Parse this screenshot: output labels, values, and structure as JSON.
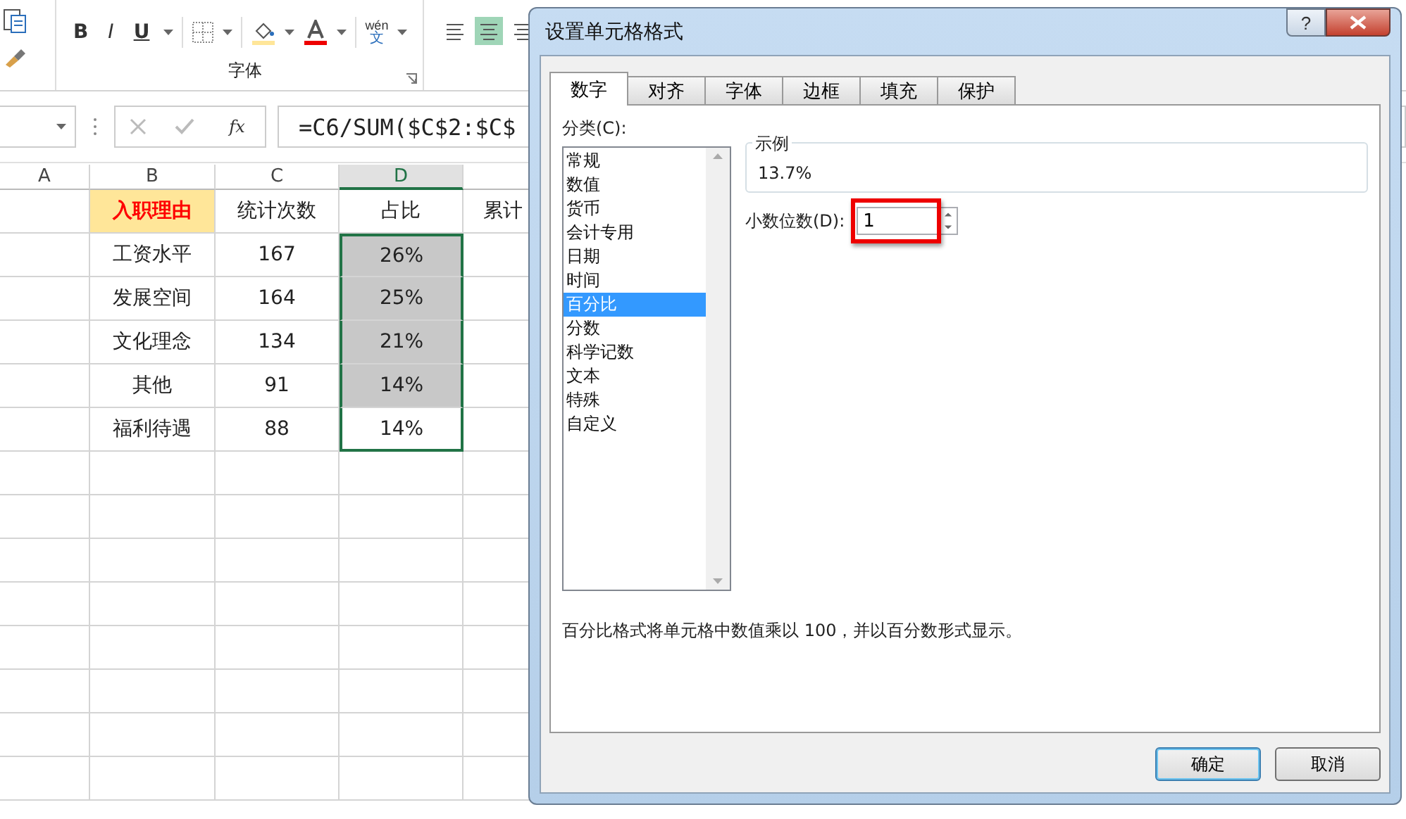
{
  "ribbon": {
    "font_buttons": [
      {
        "kind": "bold",
        "label": "B"
      },
      {
        "kind": "italic",
        "label": "I"
      },
      {
        "kind": "underline",
        "label": "U"
      }
    ],
    "phonetic": {
      "top": "wén",
      "bottom": "文"
    },
    "font_group_label": "字体",
    "align_buttons": [
      {
        "kind": "left",
        "selected": false
      },
      {
        "kind": "center",
        "selected": true
      },
      {
        "kind": "right",
        "selected": false
      }
    ]
  },
  "formula_bar": {
    "fx": "fx",
    "formula": "=C6/SUM($C$2:$C$"
  },
  "sheet": {
    "columns": [
      {
        "label": "A",
        "selected": false
      },
      {
        "label": "B",
        "selected": false
      },
      {
        "label": "C",
        "selected": false
      },
      {
        "label": "D",
        "selected": true
      }
    ],
    "rows": [
      {
        "reason": "入职理由",
        "reason_highlight": true,
        "count": "统计次数",
        "share": {
          "text": "占比",
          "shaded": false,
          "in_selection": false
        },
        "cumulative": "累计"
      },
      {
        "reason": "工资水平",
        "reason_highlight": false,
        "count": "167",
        "share": {
          "text": "26%",
          "shaded": true,
          "in_selection": true
        }
      },
      {
        "reason": "发展空间",
        "reason_highlight": false,
        "count": "164",
        "share": {
          "text": "25%",
          "shaded": true,
          "in_selection": true
        }
      },
      {
        "reason": "文化理念",
        "reason_highlight": false,
        "count": "134",
        "share": {
          "text": "21%",
          "shaded": true,
          "in_selection": true
        }
      },
      {
        "reason": "其他",
        "reason_highlight": false,
        "count": "91",
        "share": {
          "text": "14%",
          "shaded": true,
          "in_selection": true
        }
      },
      {
        "reason": "福利待遇",
        "reason_highlight": false,
        "count": "88",
        "share": {
          "text": "14%",
          "shaded": false,
          "in_selection": true
        }
      }
    ]
  },
  "dialog": {
    "title": "设置单元格格式",
    "help": "?",
    "tabs": [
      {
        "label": "数字",
        "selected": true
      },
      {
        "label": "对齐",
        "selected": false
      },
      {
        "label": "字体",
        "selected": false
      },
      {
        "label": "边框",
        "selected": false
      },
      {
        "label": "填充",
        "selected": false
      },
      {
        "label": "保护",
        "selected": false
      }
    ],
    "category_label": "分类(C):",
    "categories": [
      {
        "label": "常规",
        "selected": false
      },
      {
        "label": "数值",
        "selected": false
      },
      {
        "label": "货币",
        "selected": false
      },
      {
        "label": "会计专用",
        "selected": false
      },
      {
        "label": "日期",
        "selected": false
      },
      {
        "label": "时间",
        "selected": false
      },
      {
        "label": "百分比",
        "selected": true
      },
      {
        "label": "分数",
        "selected": false
      },
      {
        "label": "科学记数",
        "selected": false
      },
      {
        "label": "文本",
        "selected": false
      },
      {
        "label": "特殊",
        "selected": false
      },
      {
        "label": "自定义",
        "selected": false
      }
    ],
    "sample_label": "示例",
    "sample_value": "13.7%",
    "decimal_label": "小数位数(D):",
    "decimal_value": "1",
    "decimal_highlighted": true,
    "description": "百分比格式将单元格中数值乘以 100，并以百分数形式显示。",
    "buttons": [
      {
        "label": "确定",
        "default": true
      },
      {
        "label": "取消",
        "default": false
      }
    ]
  }
}
